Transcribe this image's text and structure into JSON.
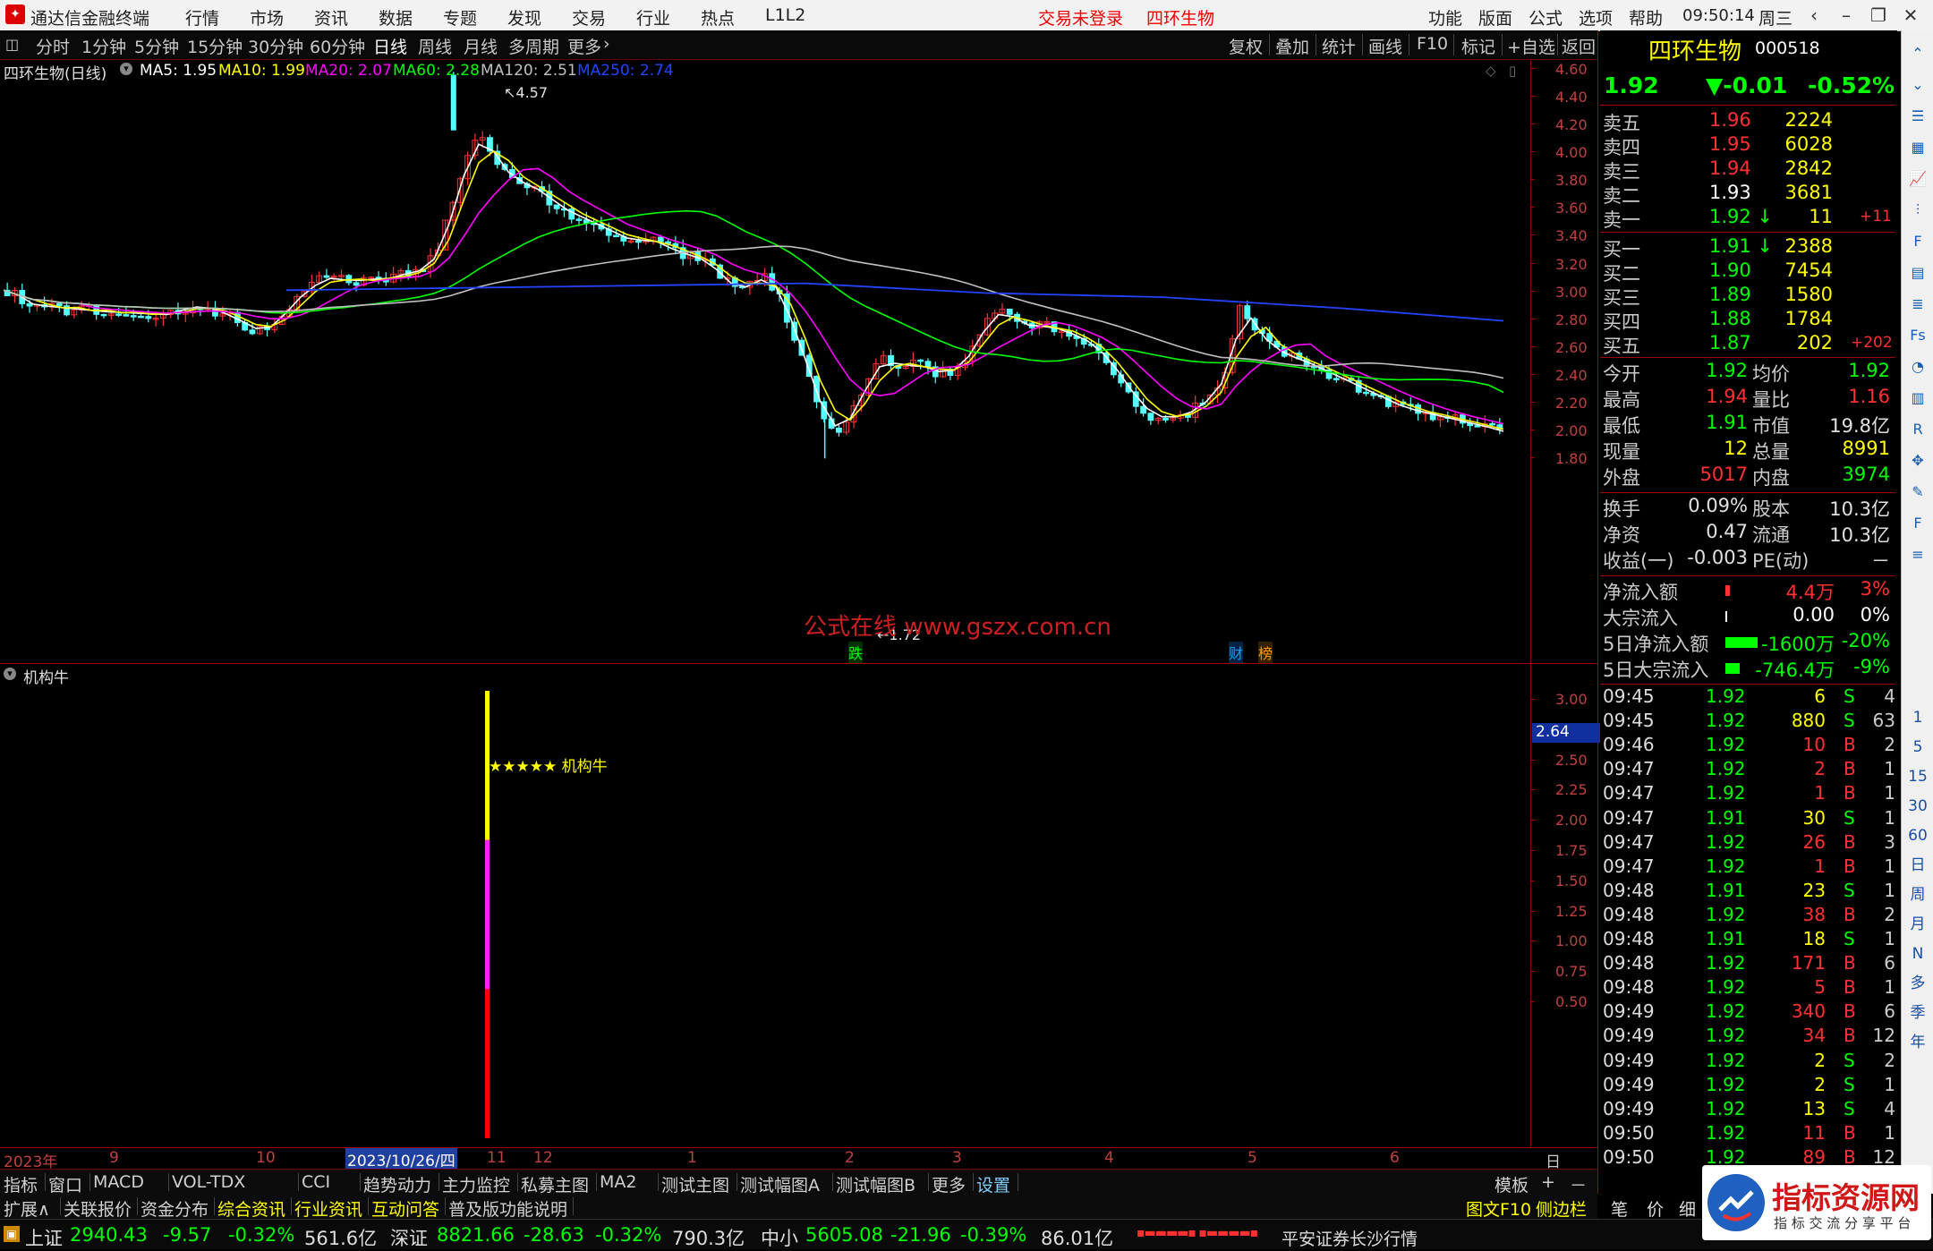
{
  "titlebar": {
    "app_name": "通达信金融终端",
    "menus": [
      "行情",
      "市场",
      "资讯",
      "数据",
      "专题",
      "发现",
      "交易",
      "行业",
      "热点",
      "L1L2"
    ],
    "login_status": "交易未登录",
    "stock_name": "四环生物",
    "right_menus": [
      "功能",
      "版面",
      "公式",
      "选项",
      "帮助"
    ],
    "time": "09:50:14",
    "weekday": "周三"
  },
  "period_bar": {
    "items": [
      "分时",
      "1分钟",
      "5分钟",
      "15分钟",
      "30分钟",
      "60分钟",
      "日线",
      "周线",
      "月线",
      "多周期",
      "更多"
    ],
    "active": "日线",
    "right_buttons": [
      "复权",
      "叠加",
      "统计",
      "画线",
      "F10",
      "标记",
      "+自选",
      "返回"
    ]
  },
  "main_chart": {
    "title": "四环生物(日线)",
    "ma_labels": [
      {
        "text": "MA5: 1.95",
        "color": "#ffffff"
      },
      {
        "text": "MA10: 1.99",
        "color": "#ffff00"
      },
      {
        "text": "MA20: 2.07",
        "color": "#ff00ff"
      },
      {
        "text": "MA60: 2.28",
        "color": "#00ff00"
      },
      {
        "text": "MA120: 2.51",
        "color": "#c0c0c0"
      },
      {
        "text": "MA250: 2.74",
        "color": "#2244ff"
      }
    ],
    "y_ticks": [
      "4.60",
      "4.40",
      "4.20",
      "4.00",
      "3.80",
      "3.60",
      "3.40",
      "3.20",
      "3.00",
      "2.80",
      "2.60",
      "2.40",
      "2.20",
      "2.00",
      "1.80"
    ],
    "high_label": "4.57",
    "low_label": "1.72",
    "watermark": "公式在线  www.gszx.com.cn",
    "markers": [
      {
        "text": "跌",
        "color": "#00ff00"
      },
      {
        "text": "财",
        "color": "#00aaff"
      },
      {
        "text": "榜",
        "color": "#ff9900"
      }
    ]
  },
  "indicator": {
    "name": "机构牛",
    "y_ticks": [
      "3.00",
      "2.50",
      "2.25",
      "2.00",
      "1.75",
      "1.50",
      "1.25",
      "1.00",
      "0.75",
      "0.50"
    ],
    "current_value": "2.64",
    "signal_label": "★★★★★ 机构牛"
  },
  "x_axis": {
    "labels": [
      "2023年",
      "9",
      "10",
      "2023/10/26/四",
      "11",
      "12",
      "1",
      "2",
      "3",
      "4",
      "5",
      "6"
    ],
    "period": "日线"
  },
  "chart_data": {
    "type": "candlestick",
    "title": "四环生物(日线)",
    "ylim": [
      1.7,
      4.65
    ],
    "close_path": [
      2.95,
      2.88,
      2.82,
      2.85,
      2.8,
      2.83,
      2.78,
      2.81,
      2.77,
      2.8,
      2.76,
      2.79,
      2.82,
      2.84,
      2.8,
      2.76,
      2.7,
      2.65,
      2.72,
      2.85,
      2.95,
      3.02,
      3.05,
      3.0,
      3.04,
      3.02,
      3.05,
      3.08,
      3.1,
      3.25,
      3.6,
      3.95,
      4.05,
      3.85,
      3.75,
      3.7,
      3.65,
      3.55,
      3.5,
      3.45,
      3.4,
      3.35,
      3.3,
      3.32,
      3.28,
      3.22,
      3.2,
      3.15,
      3.05,
      2.95,
      3.0,
      3.05,
      2.9,
      2.6,
      2.3,
      2.0,
      1.95,
      2.1,
      2.35,
      2.45,
      2.4,
      2.42,
      2.38,
      2.35,
      2.4,
      2.55,
      2.75,
      2.8,
      2.72,
      2.68,
      2.7,
      2.65,
      2.62,
      2.55,
      2.45,
      2.3,
      2.15,
      2.05,
      2.03,
      2.05,
      2.1,
      2.2,
      2.35,
      2.85,
      2.65,
      2.55,
      2.48,
      2.45,
      2.4,
      2.35,
      2.3,
      2.25,
      2.2,
      2.15,
      2.1,
      2.08,
      2.05,
      2.03,
      2.0,
      1.98,
      1.95,
      1.92
    ],
    "indicator_bar": {
      "x_index": 30,
      "segments": [
        {
          "from": 0,
          "to": 1,
          "color": "red"
        },
        {
          "from": 1,
          "to": 2,
          "color": "magenta"
        },
        {
          "from": 2,
          "to": 3,
          "color": "yellow"
        }
      ]
    }
  },
  "quote": {
    "name": "四环生物",
    "code": "000518",
    "price": "1.92",
    "change": "▼-0.01",
    "pct": "-0.52%",
    "asks": [
      {
        "label": "卖五",
        "price": "1.96",
        "vol": "2224",
        "extra": ""
      },
      {
        "label": "卖四",
        "price": "1.95",
        "vol": "6028",
        "extra": ""
      },
      {
        "label": "卖三",
        "price": "1.94",
        "vol": "2842",
        "extra": ""
      },
      {
        "label": "卖二",
        "price": "1.93",
        "vol": "3681",
        "extra": ""
      },
      {
        "label": "卖一",
        "price": "1.92 ↓",
        "vol": "11",
        "extra": "+11"
      }
    ],
    "bids": [
      {
        "label": "买一",
        "price": "1.91 ↓",
        "vol": "2388",
        "extra": ""
      },
      {
        "label": "买二",
        "price": "1.90",
        "vol": "7454",
        "extra": ""
      },
      {
        "label": "买三",
        "price": "1.89",
        "vol": "1580",
        "extra": ""
      },
      {
        "label": "买四",
        "price": "1.88",
        "vol": "1784",
        "extra": ""
      },
      {
        "label": "买五",
        "price": "1.87",
        "vol": "202",
        "extra": "+202"
      }
    ],
    "stats": [
      {
        "l1": "今开",
        "v1": "1.92",
        "c1": "#00ff00",
        "l2": "均价",
        "v2": "1.92",
        "c2": "#00ff00"
      },
      {
        "l1": "最高",
        "v1": "1.94",
        "c1": "#ff3030",
        "l2": "量比",
        "v2": "1.16",
        "c2": "#ff3030"
      },
      {
        "l1": "最低",
        "v1": "1.91",
        "c1": "#00ff00",
        "l2": "市值",
        "v2": "19.8亿",
        "c2": "#e0e0e0"
      },
      {
        "l1": "现量",
        "v1": "12",
        "c1": "#ffff00",
        "l2": "总量",
        "v2": "8991",
        "c2": "#ffff00"
      },
      {
        "l1": "外盘",
        "v1": "5017",
        "c1": "#ff3030",
        "l2": "内盘",
        "v2": "3974",
        "c2": "#00ff00"
      }
    ],
    "stats2": [
      {
        "l1": "换手",
        "v1": "0.09%",
        "l2": "股本",
        "v2": "10.3亿"
      },
      {
        "l1": "净资",
        "v1": "0.47",
        "l2": "流通",
        "v2": "10.3亿"
      },
      {
        "l1": "收益(一)",
        "v1": "-0.003",
        "l2": "PE(动)",
        "v2": "－"
      }
    ],
    "flows": [
      {
        "label": "净流入额",
        "value": "4.4万",
        "pct": "3%",
        "color": "#ff3030",
        "fill": 0.03
      },
      {
        "label": "大宗流入",
        "value": "0.00",
        "pct": "0%",
        "color": "#ffffff",
        "fill": 0.0
      },
      {
        "label": "5日净流入额",
        "value": "-1600万",
        "pct": "-20%",
        "color": "#00ff00",
        "fill": 0.2
      },
      {
        "label": "5日大宗流入",
        "value": "-746.4万",
        "pct": "-9%",
        "color": "#00ff00",
        "fill": 0.09
      }
    ],
    "ticks": [
      {
        "t": "09:45",
        "p": "1.92",
        "v": "6",
        "bs": "S",
        "n": "4"
      },
      {
        "t": "09:45",
        "p": "1.92",
        "v": "880",
        "bs": "S",
        "n": "63"
      },
      {
        "t": "09:46",
        "p": "1.92",
        "v": "10",
        "bs": "B",
        "n": "2"
      },
      {
        "t": "09:47",
        "p": "1.92",
        "v": "2",
        "bs": "B",
        "n": "1"
      },
      {
        "t": "09:47",
        "p": "1.92",
        "v": "1",
        "bs": "B",
        "n": "1"
      },
      {
        "t": "09:47",
        "p": "1.91",
        "v": "30",
        "bs": "S",
        "n": "1"
      },
      {
        "t": "09:47",
        "p": "1.92",
        "v": "26",
        "bs": "B",
        "n": "3"
      },
      {
        "t": "09:47",
        "p": "1.92",
        "v": "1",
        "bs": "B",
        "n": "1"
      },
      {
        "t": "09:48",
        "p": "1.91",
        "v": "23",
        "bs": "S",
        "n": "1"
      },
      {
        "t": "09:48",
        "p": "1.92",
        "v": "38",
        "bs": "B",
        "n": "2"
      },
      {
        "t": "09:48",
        "p": "1.91",
        "v": "18",
        "bs": "S",
        "n": "1"
      },
      {
        "t": "09:48",
        "p": "1.92",
        "v": "171",
        "bs": "B",
        "n": "6"
      },
      {
        "t": "09:48",
        "p": "1.92",
        "v": "5",
        "bs": "B",
        "n": "1"
      },
      {
        "t": "09:49",
        "p": "1.92",
        "v": "340",
        "bs": "B",
        "n": "6"
      },
      {
        "t": "09:49",
        "p": "1.92",
        "v": "34",
        "bs": "B",
        "n": "12"
      },
      {
        "t": "09:49",
        "p": "1.92",
        "v": "2",
        "bs": "S",
        "n": "2"
      },
      {
        "t": "09:49",
        "p": "1.92",
        "v": "2",
        "bs": "S",
        "n": "1"
      },
      {
        "t": "09:49",
        "p": "1.92",
        "v": "13",
        "bs": "S",
        "n": "4"
      },
      {
        "t": "09:50",
        "p": "1.92",
        "v": "11",
        "bs": "B",
        "n": "1"
      },
      {
        "t": "09:50",
        "p": "1.92",
        "v": "89",
        "bs": "B",
        "n": "12"
      },
      {
        "t": "09:50",
        "p": "1.92",
        "v": "",
        "bs": "",
        "n": ""
      }
    ]
  },
  "tabs_row1": [
    "指标",
    "窗口",
    "MACD",
    "VOL-TDX",
    "CCI",
    "趋势动力",
    "主力监控",
    "私募主图",
    "MA2",
    "测试主图",
    "测试幅图A",
    "测试幅图B",
    "更多",
    "设置"
  ],
  "tabs_row1_right": [
    "模板",
    "+",
    "－"
  ],
  "tabs_row2": [
    "扩展∧",
    "关联报价",
    "资金分布",
    "综合资讯",
    "行业资讯",
    "互动问答",
    "普及版功能说明"
  ],
  "tabs_row2_right": [
    "图文F10",
    "侧边栏《",
    "笔",
    "价",
    "细"
  ],
  "statusbar": {
    "sh_name": "上证",
    "sh_val": "2940.43",
    "sh_chg": "-9.57",
    "sh_pct": "-0.32%",
    "sh_amt": "561.6亿",
    "sz_name": "深证",
    "sz_val": "8821.66",
    "sz_chg": "-28.63",
    "sz_pct": "-0.32%",
    "sz_amt": "790.3亿",
    "zx_name": "中小",
    "zx_val": "5605.08",
    "zx_chg": "-21.96",
    "zx_pct": "-0.39%",
    "zx_amt": "86.01亿",
    "broker": "平安证券长沙行情"
  },
  "brand_logo": {
    "title": "指标资源网",
    "subtitle": "指 标 交 流 分 享 平 台"
  },
  "sidebar_icons": [
    "up-arrow-icon",
    "down-arrow-icon",
    "list-icon",
    "grid-icon",
    "chart-icon",
    "candle-icon",
    "f10-icon",
    "doc-icon",
    "news-icon",
    "fs-icon",
    "gauge-icon",
    "tick-icon",
    "rsi-icon",
    "move-icon",
    "pen-icon",
    "fs2-icon",
    "stack-icon"
  ],
  "sidebar_periods": [
    "1",
    "5",
    "15",
    "30",
    "60",
    "日",
    "周",
    "月",
    "N",
    "多",
    "季",
    "年"
  ]
}
